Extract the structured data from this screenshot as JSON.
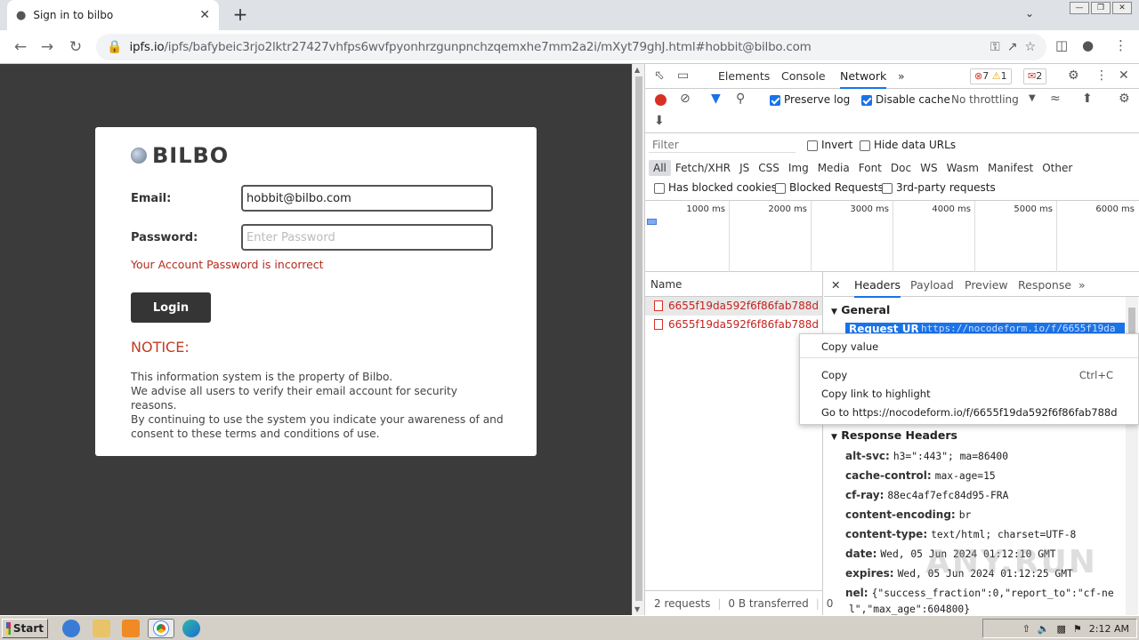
{
  "browser": {
    "tab_title": "Sign in to bilbo",
    "url_host": "ipfs.io",
    "url_path": "/ipfs/bafybeic3rjo2lktr27427vhfps6wvfpyonhrzgunpnchzqemxhe7mm2a2i/mXyt79ghJ.html#hobbit@bilbo.com"
  },
  "page": {
    "brand": "BILBO",
    "email_label": "Email:",
    "email_value": "hobbit@bilbo.com",
    "password_label": "Password:",
    "password_placeholder": "Enter Password",
    "error": "Your Account Password is incorrect",
    "login_label": "Login",
    "notice_title": "NOTICE:",
    "notice_lines": [
      "This information system is the property of Bilbo.",
      "We advise all users to verify their email account for security reasons.",
      "By continuing to use the system you indicate your awareness of and",
      "consent to these terms and conditions of use."
    ]
  },
  "devtools": {
    "tabs": [
      "Elements",
      "Console",
      "Network"
    ],
    "errors": "7",
    "warnings": "1",
    "issues": "2",
    "preserve_log": "Preserve log",
    "disable_cache": "Disable cache",
    "throttling": "No throttling",
    "filter_placeholder": "Filter",
    "invert": "Invert",
    "hide_data_urls": "Hide data URLs",
    "types": [
      "All",
      "Fetch/XHR",
      "JS",
      "CSS",
      "Img",
      "Media",
      "Font",
      "Doc",
      "WS",
      "Wasm",
      "Manifest",
      "Other"
    ],
    "has_blocked_cookies": "Has blocked cookies",
    "blocked_requests": "Blocked Requests",
    "third_party": "3rd-party requests",
    "timeline_ticks": [
      "1000 ms",
      "2000 ms",
      "3000 ms",
      "4000 ms",
      "5000 ms",
      "6000 ms"
    ],
    "name_header": "Name",
    "requests": [
      "6655f19da592f6f86fab788d",
      "6655f19da592f6f86fab788d"
    ],
    "status_requests": "2 requests",
    "status_transferred": "0 B transferred",
    "status_extra": "0",
    "detail_tabs": [
      "Headers",
      "Payload",
      "Preview",
      "Response"
    ],
    "general": "General",
    "request_url_key": "Request URL:",
    "request_url_value": "https://nocodeform.io/f/6655f19da",
    "response_headers": "Response Headers",
    "headers": [
      {
        "k": "alt-svc:",
        "v": "h3=\":443\"; ma=86400"
      },
      {
        "k": "cache-control:",
        "v": "max-age=15"
      },
      {
        "k": "cf-ray:",
        "v": "88ec4af7efc84d95-FRA"
      },
      {
        "k": "content-encoding:",
        "v": "br"
      },
      {
        "k": "content-type:",
        "v": "text/html; charset=UTF-8"
      },
      {
        "k": "date:",
        "v": "Wed, 05 Jun 2024 01:12:10 GMT"
      },
      {
        "k": "expires:",
        "v": "Wed, 05 Jun 2024 01:12:25 GMT"
      },
      {
        "k": "nel:",
        "v": "{\"success_fraction\":0,\"report_to\":\"cf-ne"
      },
      {
        "k": "",
        "v": "l\",\"max_age\":604800}"
      }
    ]
  },
  "context_menu": {
    "copy_value": "Copy value",
    "copy": "Copy",
    "copy_shortcut": "Ctrl+C",
    "copy_link": "Copy link to highlight",
    "goto": "Go to https://nocodeform.io/f/6655f19da592f6f86fab788d"
  },
  "taskbar": {
    "start": "Start",
    "time": "2:12 AM"
  },
  "watermark": "ANY.RUN"
}
